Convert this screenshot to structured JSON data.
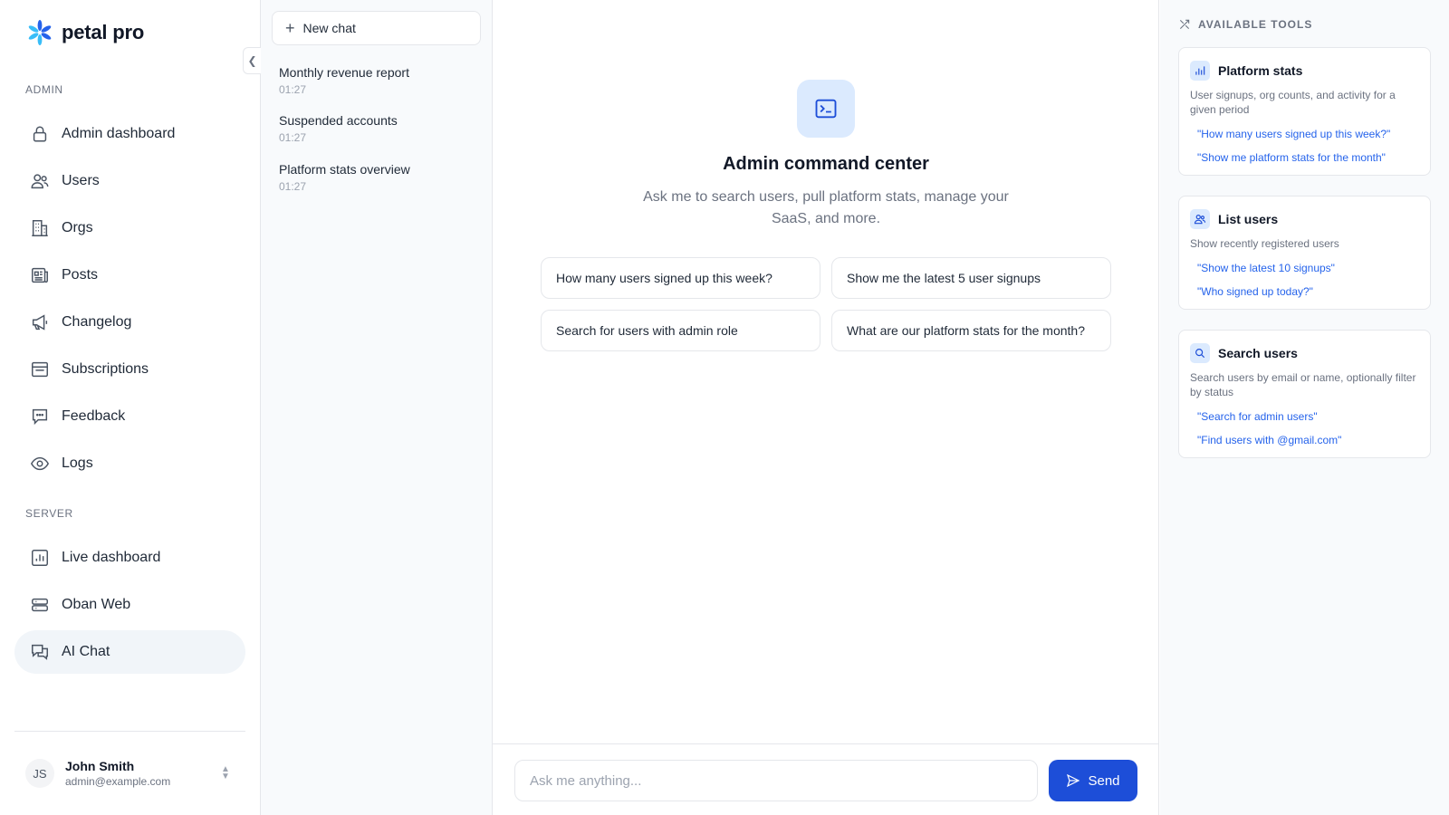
{
  "brand": {
    "name": "petal pro"
  },
  "sidebar": {
    "sections": {
      "admin": "ADMIN",
      "server": "SERVER"
    },
    "items": [
      {
        "label": "Admin dashboard",
        "icon": "lock-icon"
      },
      {
        "label": "Users",
        "icon": "users-icon"
      },
      {
        "label": "Orgs",
        "icon": "building-icon"
      },
      {
        "label": "Posts",
        "icon": "newspaper-icon"
      },
      {
        "label": "Changelog",
        "icon": "megaphone-icon"
      },
      {
        "label": "Subscriptions",
        "icon": "archive-box-icon"
      },
      {
        "label": "Feedback",
        "icon": "chat-bubble-icon"
      },
      {
        "label": "Logs",
        "icon": "eye-icon"
      }
    ],
    "server_items": [
      {
        "label": "Live dashboard",
        "icon": "chart-bar-icon"
      },
      {
        "label": "Oban Web",
        "icon": "server-stack-icon"
      },
      {
        "label": "AI Chat",
        "icon": "chat-bubbles-icon",
        "active": true
      }
    ],
    "user": {
      "initials": "JS",
      "name": "John Smith",
      "email": "admin@example.com"
    }
  },
  "chatlist": {
    "new_chat_label": "New chat",
    "items": [
      {
        "title": "Monthly revenue report",
        "time": "01:27"
      },
      {
        "title": "Suspended accounts",
        "time": "01:27"
      },
      {
        "title": "Platform stats overview",
        "time": "01:27"
      }
    ]
  },
  "main": {
    "title": "Admin command center",
    "subtitle": "Ask me to search users, pull platform stats, manage your SaaS, and more.",
    "suggestions": [
      "How many users signed up this week?",
      "Show me the latest 5 user signups",
      "Search for users with admin role",
      "What are our platform stats for the month?"
    ],
    "input": {
      "placeholder": "Ask me anything...",
      "value": ""
    },
    "send_label": "Send"
  },
  "tools": {
    "heading": "AVAILABLE TOOLS",
    "cards": [
      {
        "title": "Platform stats",
        "icon": "chart-bar-icon",
        "description": "User signups, org counts, and activity for a given period",
        "examples": [
          "\"How many users signed up this week?\"",
          "\"Show me platform stats for the month\""
        ]
      },
      {
        "title": "List users",
        "icon": "users-icon",
        "description": "Show recently registered users",
        "examples": [
          "\"Show the latest 10 signups\"",
          "\"Who signed up today?\""
        ]
      },
      {
        "title": "Search users",
        "icon": "search-icon",
        "description": "Search users by email or name, optionally filter by status",
        "examples": [
          "\"Search for admin users\"",
          "\"Find users with @gmail.com\""
        ]
      }
    ]
  },
  "colors": {
    "accent": "#1d4ed8",
    "link": "#2563eb",
    "icon_bg": "#dbeafe",
    "brand_logo": "#2563eb"
  }
}
